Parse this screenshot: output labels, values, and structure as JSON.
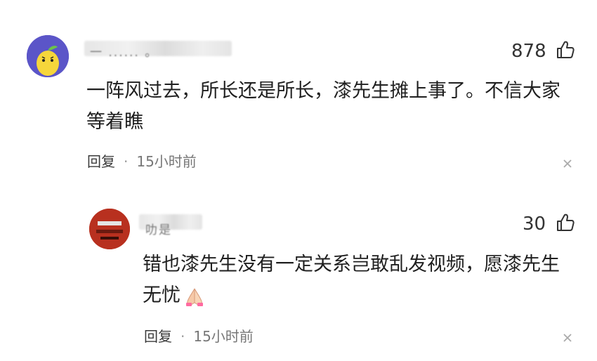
{
  "comments": [
    {
      "username_visible": "一 ...... 。",
      "like_count": "878",
      "text_line1": "一阵风过去，所长还是所长，漆先生摊上事了。不信大家",
      "text_line2": "等着瞧",
      "reply_label": "回复",
      "separator": "·",
      "time": "15小时前"
    },
    {
      "username_visible": "叻是",
      "like_count": "30",
      "text_line1": "错也漆先生没有一定关系岂敢乱发视频，愿漆先生",
      "text_line2": "无忧",
      "reply_label": "回复",
      "separator": "·",
      "time": "15小时前"
    }
  ],
  "icons": {
    "like": "thumbs-up-icon",
    "close": "close-icon",
    "emoji": "folded-hands-emoji"
  },
  "colors": {
    "avatar1_bg": "#5b55c8",
    "avatar2_bg": "#b8301f",
    "text": "#1f1f1f",
    "meta": "#777777"
  }
}
